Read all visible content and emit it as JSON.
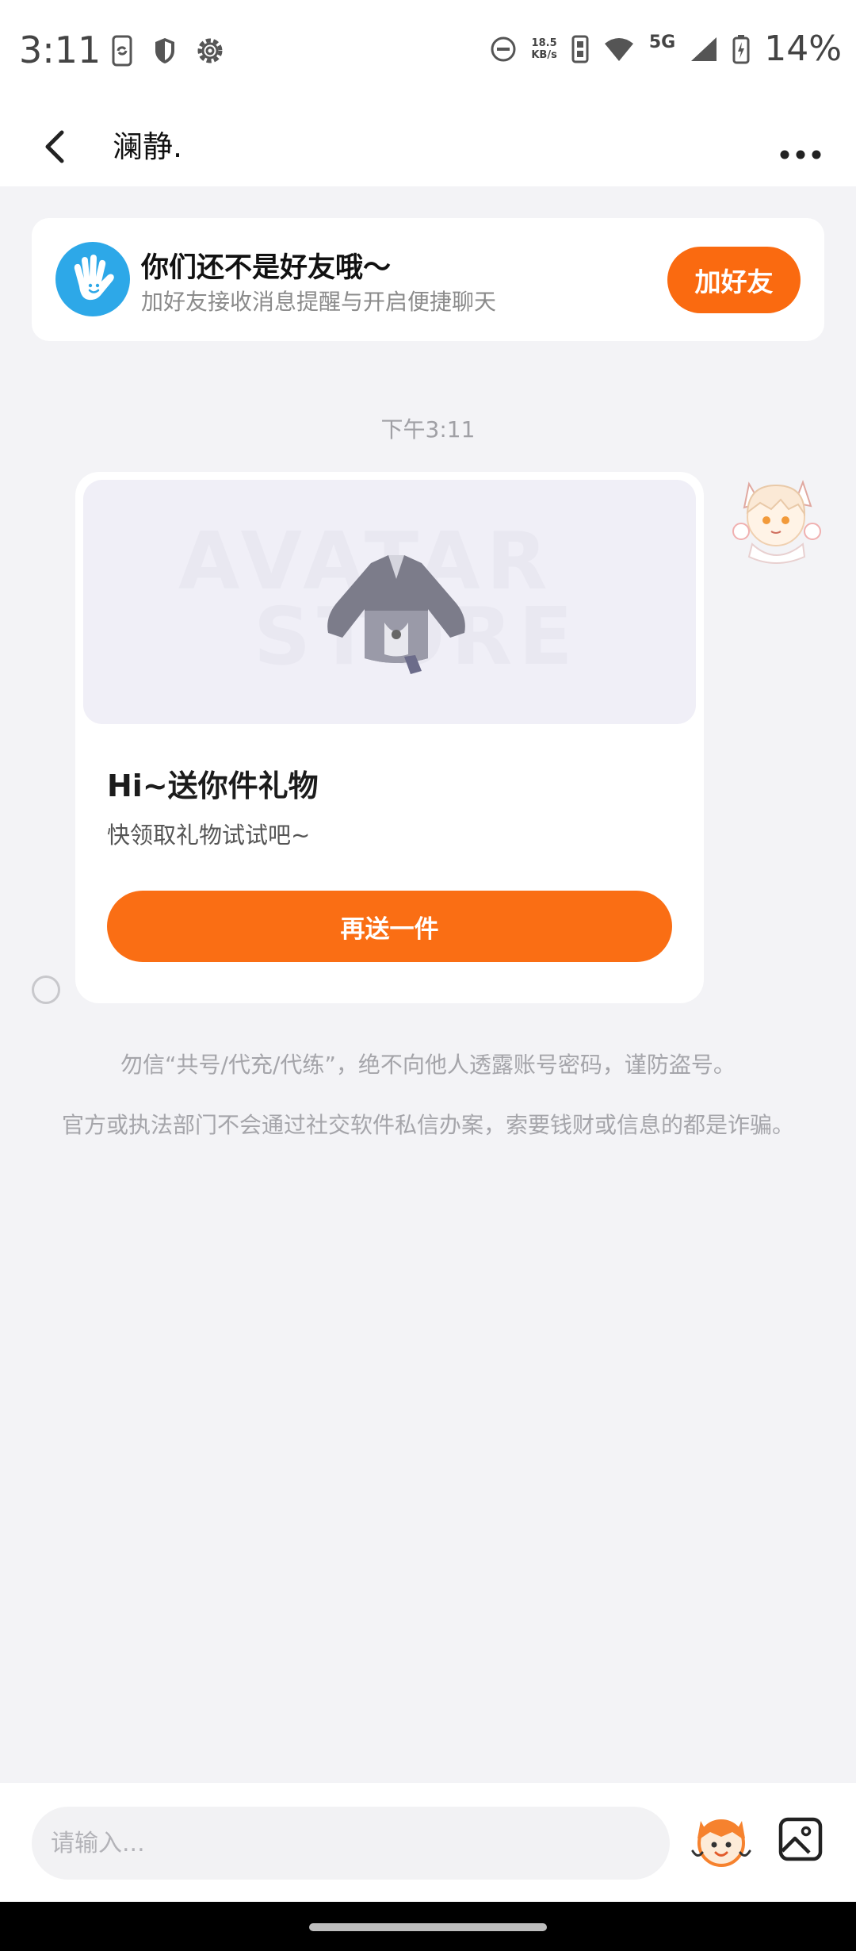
{
  "status_bar": {
    "time": "3:11",
    "net_speed_value": "18.5",
    "net_speed_unit": "KB/s",
    "network": "5G",
    "battery": "14%"
  },
  "header": {
    "title": "澜静."
  },
  "friend_banner": {
    "title": "你们还不是好友哦～",
    "subtitle": "加好友接收消息提醒与开启便捷聊天",
    "button": "加好友"
  },
  "chat": {
    "timestamp": "下午3:11",
    "gift_card": {
      "watermark_line1": "AVATAR",
      "watermark_line2": "STORE",
      "title": "Hi~送你件礼物",
      "subtitle": "快领取礼物试试吧~",
      "button": "再送一件"
    }
  },
  "notices": {
    "line1": "勿信“共号/代充/代练”，绝不向他人透露账号密码，谨防盗号。",
    "line2": "官方或执法部门不会通过社交软件私信办案，索要钱财或信息的都是诈骗。"
  },
  "input_bar": {
    "placeholder": "请输入..."
  },
  "colors": {
    "accent": "#fa6a10",
    "banner_icon": "#2da8e8",
    "background": "#f3f3f6"
  }
}
